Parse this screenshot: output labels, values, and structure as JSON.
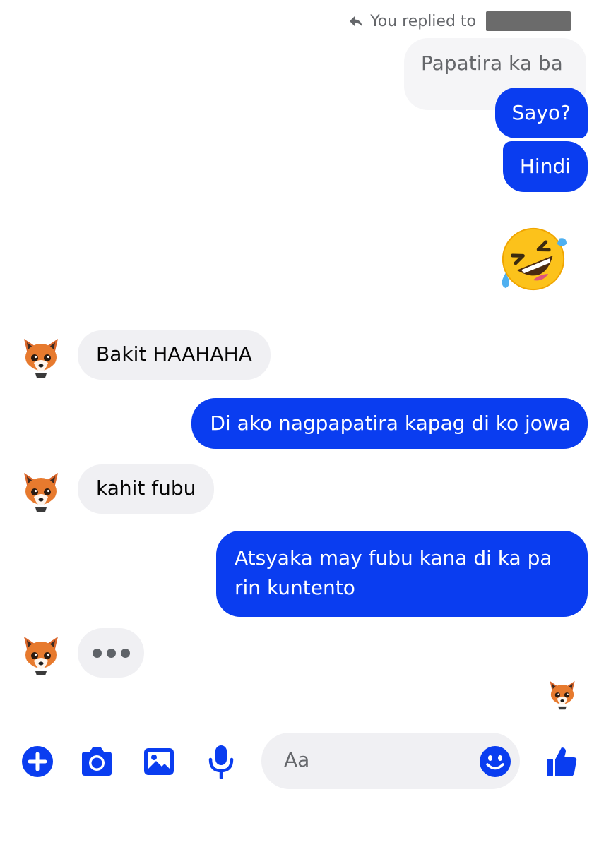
{
  "reply_header": {
    "text": "You replied to"
  },
  "quoted_message": {
    "text": "Papatira ka ba"
  },
  "messages": [
    {
      "from": "me",
      "text": "Sayo?"
    },
    {
      "from": "me",
      "text": "Hindi"
    },
    {
      "from": "me",
      "emoji": "rolling-on-floor-laughing"
    },
    {
      "from": "them",
      "text": "Bakit HAAHAHA"
    },
    {
      "from": "me",
      "text": "Di ako nagpapatira kapag di ko jowa"
    },
    {
      "from": "them",
      "text": "kahit fubu"
    },
    {
      "from": "me",
      "lines": [
        "Atsyaka may fubu kana di ka pa",
        "rin kuntento"
      ]
    },
    {
      "from": "them",
      "typing": true
    }
  ],
  "composer": {
    "placeholder": "Aa"
  },
  "icons": [
    "reply-icon",
    "fox-avatar-icon",
    "rolling-laughing-emoji-icon",
    "plus-icon",
    "camera-icon",
    "image-icon",
    "microphone-icon",
    "smiley-icon",
    "thumbs-up-icon"
  ],
  "colors": {
    "accent": "#0a3df0",
    "incoming_bubble": "#f0f0f3"
  }
}
